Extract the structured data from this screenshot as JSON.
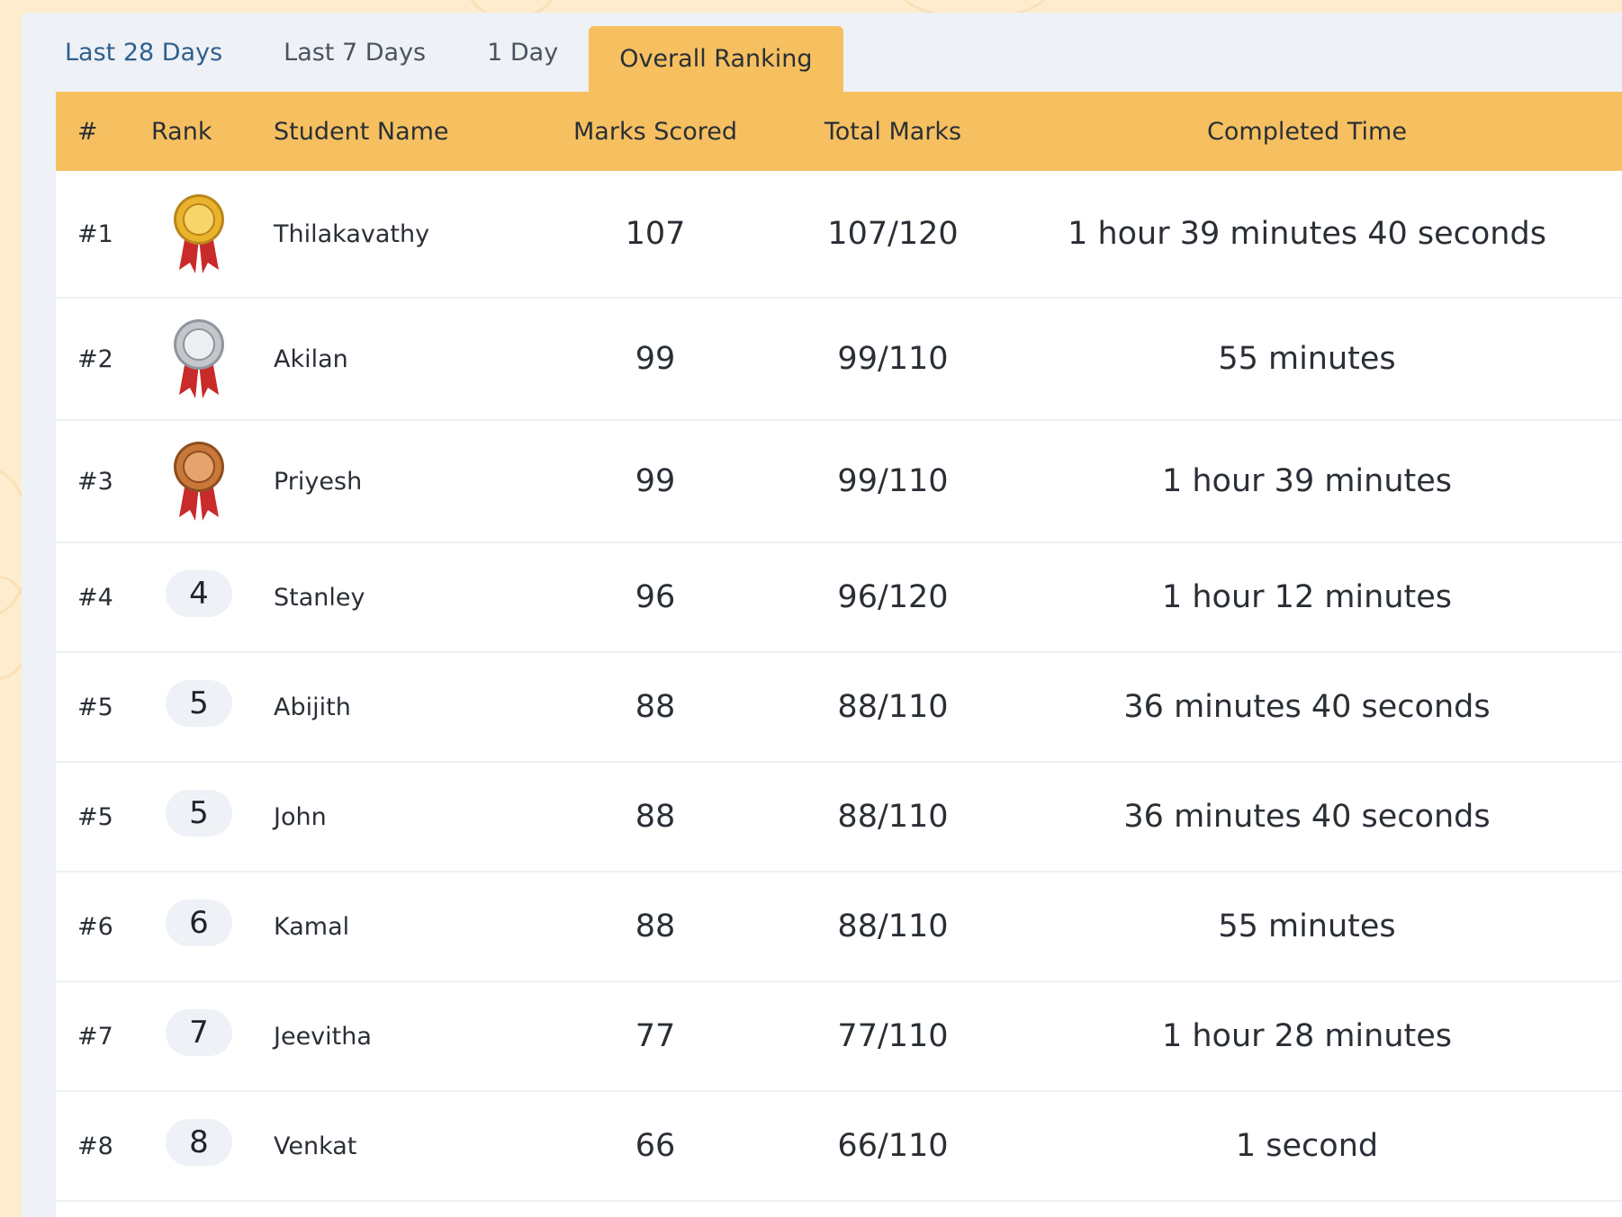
{
  "tabs": [
    {
      "label": "Last 28 Days",
      "active": false
    },
    {
      "label": "Last 7 Days",
      "active": false
    },
    {
      "label": "1 Day",
      "active": false
    },
    {
      "label": "Overall Ranking",
      "active": true
    }
  ],
  "colors": {
    "accent": "#f6c060",
    "background": "#fdeccd",
    "gold": "#e9b32c",
    "silver": "#c3c7cc",
    "bronze": "#c9783a",
    "ribbon": "#c92a2a"
  },
  "table": {
    "headers": {
      "num": "#",
      "rank": "Rank",
      "name": "Student Name",
      "marks": "Marks Scored",
      "total": "Total Marks",
      "time": "Completed Time"
    },
    "rows": [
      {
        "num": "#1",
        "rank": "1",
        "medal": "gold-medal-icon",
        "name": "Thilakavathy",
        "marks": "107",
        "total": "107/120",
        "time": "1 hour 39 minutes 40 seconds"
      },
      {
        "num": "#2",
        "rank": "2",
        "medal": "silver-medal-icon",
        "name": "Akilan",
        "marks": "99",
        "total": "99/110",
        "time": "55 minutes"
      },
      {
        "num": "#3",
        "rank": "3",
        "medal": "bronze-medal-icon",
        "name": "Priyesh",
        "marks": "99",
        "total": "99/110",
        "time": "1 hour 39 minutes"
      },
      {
        "num": "#4",
        "rank": "4",
        "medal": "",
        "name": "Stanley",
        "marks": "96",
        "total": "96/120",
        "time": "1 hour 12 minutes"
      },
      {
        "num": "#5",
        "rank": "5",
        "medal": "",
        "name": "Abijith",
        "marks": "88",
        "total": "88/110",
        "time": "36 minutes 40 seconds"
      },
      {
        "num": "#5",
        "rank": "5",
        "medal": "",
        "name": "John",
        "marks": "88",
        "total": "88/110",
        "time": "36 minutes 40 seconds"
      },
      {
        "num": "#6",
        "rank": "6",
        "medal": "",
        "name": "Kamal",
        "marks": "88",
        "total": "88/110",
        "time": "55 minutes"
      },
      {
        "num": "#7",
        "rank": "7",
        "medal": "",
        "name": "Jeevitha",
        "marks": "77",
        "total": "77/110",
        "time": "1 hour 28 minutes"
      },
      {
        "num": "#8",
        "rank": "8",
        "medal": "",
        "name": "Venkat",
        "marks": "66",
        "total": "66/110",
        "time": "1 second"
      }
    ]
  }
}
